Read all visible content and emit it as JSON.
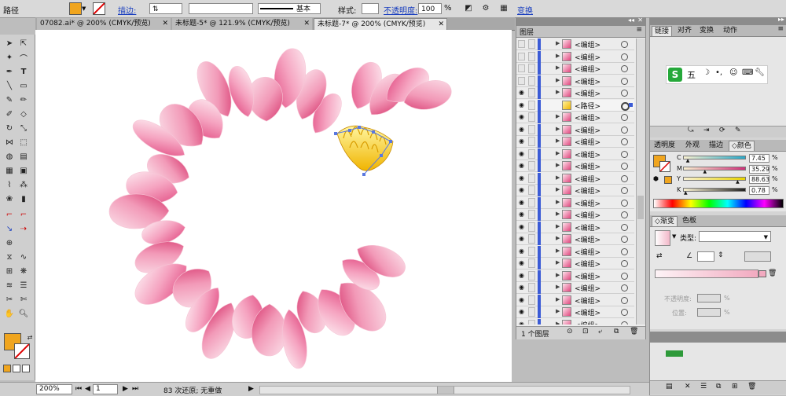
{
  "control_bar": {
    "object_type": "路径",
    "stroke_label": "描边:",
    "stroke_style_label": "基本",
    "style_label": "样式:",
    "opacity_label": "不透明度:",
    "opacity_value": "100",
    "opacity_unit": "%",
    "transform_link": "变换",
    "fill_color": "#f0a51e"
  },
  "doc_tabs": [
    {
      "label": "07082.ai* @ 200% (CMYK/预览)",
      "active": false
    },
    {
      "label": "未标题-5* @ 121.9% (CMYK/预览)",
      "active": false
    },
    {
      "label": "未标题-7* @ 200% (CMYK/预览)",
      "active": true
    }
  ],
  "status_bar": {
    "zoom": "200%",
    "page": "1",
    "history": "83 次还原; 无重做"
  },
  "layers_panel": {
    "title": "图层",
    "rows": [
      {
        "name": "<编组>",
        "visible": false,
        "selected": false
      },
      {
        "name": "<编组>",
        "visible": false,
        "selected": false
      },
      {
        "name": "<编组>",
        "visible": false,
        "selected": false
      },
      {
        "name": "<编组>",
        "visible": false,
        "selected": false
      },
      {
        "name": "<编组>",
        "visible": true,
        "selected": false
      },
      {
        "name": "<路径>",
        "visible": true,
        "selected": true
      },
      {
        "name": "<编组>",
        "visible": true,
        "selected": false
      },
      {
        "name": "<编组>",
        "visible": true,
        "selected": false
      },
      {
        "name": "<编组>",
        "visible": true,
        "selected": false
      },
      {
        "name": "<编组>",
        "visible": true,
        "selected": false
      },
      {
        "name": "<编组>",
        "visible": true,
        "selected": false
      },
      {
        "name": "<编组>",
        "visible": true,
        "selected": false
      },
      {
        "name": "<编组>",
        "visible": true,
        "selected": false
      },
      {
        "name": "<编组>",
        "visible": true,
        "selected": false
      },
      {
        "name": "<编组>",
        "visible": true,
        "selected": false
      },
      {
        "name": "<编组>",
        "visible": true,
        "selected": false
      },
      {
        "name": "<编组>",
        "visible": true,
        "selected": false
      },
      {
        "name": "<编组>",
        "visible": true,
        "selected": false
      },
      {
        "name": "<编组>",
        "visible": true,
        "selected": false
      },
      {
        "name": "<编组>",
        "visible": true,
        "selected": false
      },
      {
        "name": "<编组>",
        "visible": true,
        "selected": false
      },
      {
        "name": "<编组>",
        "visible": true,
        "selected": false
      },
      {
        "name": "<编组>",
        "visible": true,
        "selected": false
      },
      {
        "name": "<编组>",
        "visible": true,
        "selected": false
      }
    ],
    "footer": "1 个图层"
  },
  "right_panels": {
    "top_tabs": [
      "链接",
      "对齐",
      "变换",
      "动作"
    ],
    "ime_bar": "五",
    "color_tabs": [
      "透明度",
      "外观",
      "描边",
      "颜色"
    ],
    "cmyk": [
      {
        "channel": "C",
        "value": "7.45",
        "color": "#2aa8c8"
      },
      {
        "channel": "M",
        "value": "35.29",
        "color": "#d0307a"
      },
      {
        "channel": "Y",
        "value": "88.63",
        "color": "#e8d400"
      },
      {
        "channel": "K",
        "value": "0.78",
        "color": "#222222"
      }
    ],
    "gradient_tabs": [
      "渐变",
      "色板"
    ],
    "gradient_type_label": "类型:",
    "opacity_label": "不透明度:",
    "location_label": "位置:",
    "pct": "%"
  }
}
